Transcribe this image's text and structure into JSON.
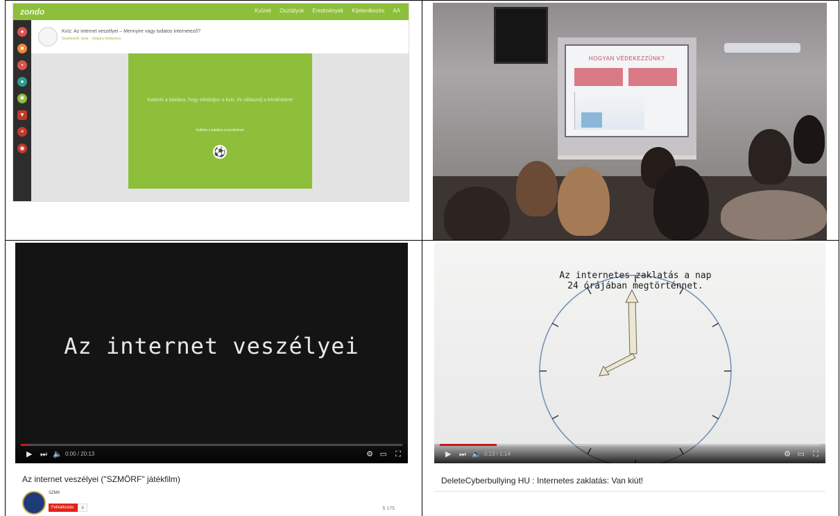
{
  "cell1": {
    "brand": "zondo",
    "nav": [
      "Kvízek",
      "Osztályok",
      "Eredmények",
      "Kijelentkezés",
      "AA"
    ],
    "quiz_title": "Kvíz: Az internet veszélyei – Mennyire vagy tudatos internetező?",
    "quiz_subtitle": "Szerkesztő: tanár · Utoljára módosítva",
    "question": "Kattints a labdára, hogy elinduljon a kvíz, és válaszolj a kérdésekre!",
    "start_hint": "Kattints a labdára a kezdéshez!",
    "ball_icon": "soccer-ball-icon",
    "sidebar_icons": [
      "user-icon",
      "chat-icon",
      "lock-icon",
      "globe-icon",
      "soccer-icon",
      "flag-icon",
      "chart-icon",
      "settings-icon"
    ],
    "accent": "#8dbf3b"
  },
  "cell2": {
    "slide_title": "HOGYAN VÉDEKEZZÜNK?",
    "slide_box_left": "",
    "slide_box_right": ""
  },
  "video1": {
    "overlay_text": "Az internet veszélyei",
    "time": "0:00 / 20:13",
    "progress_fraction": 0.02,
    "title": "Az internet veszélyei (\"SZMÖRF\" játékfilm)",
    "channel": "SZMK",
    "subscribe_label": "Feliratkozás",
    "subscriber_count": "4",
    "views": "5 175"
  },
  "video2": {
    "caption_line1": "Az internetes zaklatás a nap",
    "caption_line2": "24 órájában megtörténnet.",
    "time": "0:13 / 1:14",
    "progress_fraction": 0.15,
    "title": "DeleteCyberbullying HU : Internetes zaklatás: Van kiút!"
  },
  "controls": {
    "play_icon": "▶",
    "next_icon": "⏭",
    "volume_icon": "🔈",
    "settings_icon": "⚙",
    "theater_icon": "▭",
    "fullscreen_icon": "⛶"
  }
}
